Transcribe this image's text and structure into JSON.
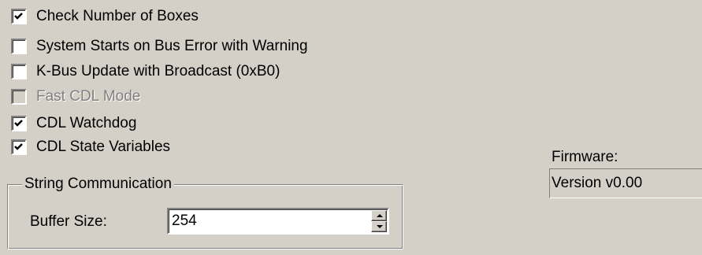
{
  "options": [
    {
      "label": "Check Number of Boxes",
      "checked": true,
      "enabled": true
    },
    {
      "label": "System Starts on Bus Error with Warning",
      "checked": false,
      "enabled": true
    },
    {
      "label": "K-Bus Update with Broadcast (0xB0)",
      "checked": false,
      "enabled": true
    },
    {
      "label": "Fast CDL Mode",
      "checked": false,
      "enabled": false
    },
    {
      "label": "CDL Watchdog",
      "checked": true,
      "enabled": true
    },
    {
      "label": "CDL State Variables",
      "checked": true,
      "enabled": true
    }
  ],
  "string_communication": {
    "title": "String Communication",
    "buffer_size_label": "Buffer Size:",
    "buffer_size_value": "254"
  },
  "firmware": {
    "label": "Firmware:",
    "value": "Version v0.00"
  },
  "colors": {
    "window_background": "#d4d0c8",
    "disabled_text": "#808080",
    "field_background": "#ffffff"
  }
}
